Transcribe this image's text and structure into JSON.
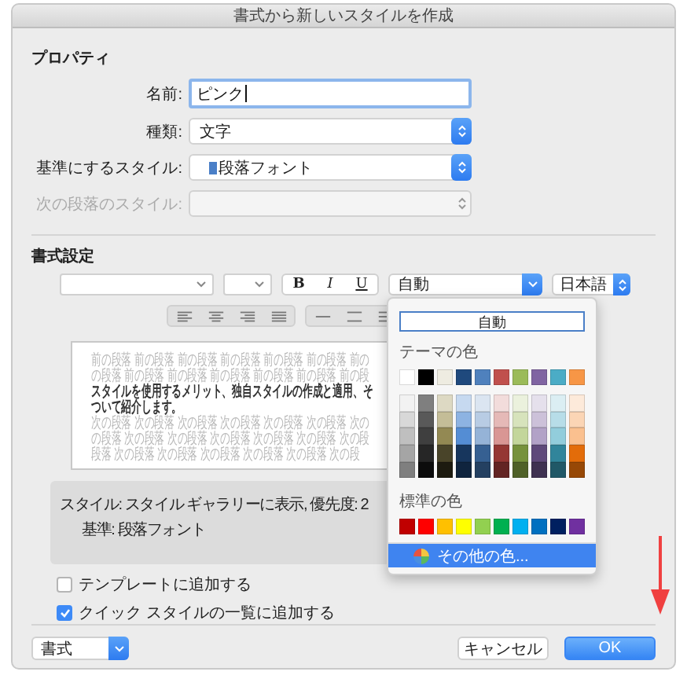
{
  "window": {
    "title": "書式から新しいスタイルを作成"
  },
  "properties": {
    "heading": "プロパティ",
    "fields": [
      {
        "kind": "text",
        "label": "名前:",
        "value": "ピンク",
        "disabled": false
      },
      {
        "kind": "select",
        "label": "種類:",
        "value": "文字",
        "disabled": false
      },
      {
        "kind": "select",
        "label": "基準にするスタイル:",
        "value": "段落フォント",
        "disabled": false
      },
      {
        "kind": "select",
        "label": "次の段落のスタイル:",
        "disabled": true
      }
    ]
  },
  "formatting": {
    "heading": "書式設定",
    "style_buttons": [
      {
        "label": "B",
        "active": false
      },
      {
        "label": "I",
        "active": false
      },
      {
        "label": "U",
        "active": false
      }
    ],
    "color_value": "自動",
    "language": "日本語",
    "preview": [
      {
        "kind": "previous",
        "text": "前の段落 前の段落 前の段落 前の段落 前の段落 前の段落 前の"
      },
      {
        "kind": "previous",
        "text": "の段落 前の段落 前の段落 前の段落 前の段落 前の段落 前の段"
      },
      {
        "kind": "current",
        "text": "スタイルを使用するメリット、独自スタイルの作成と適用、そ"
      },
      {
        "kind": "current",
        "text": "ついて紹介します。"
      },
      {
        "kind": "next",
        "text": "次の段落 次の段落 次の段落 次の段落 次の段落 次の段落 次の"
      },
      {
        "kind": "next",
        "text": "の段落 次の段落 次の段落 次の段落 次の段落 次の段落 次の段"
      },
      {
        "kind": "next",
        "text": "段落 次の段落 次の段落 次の段落 次の段落 次の段落 次の段"
      }
    ],
    "description": [
      "スタイル: スタイル ギャラリーに表示, 優先度: 2",
      "基準: 段落フォント"
    ]
  },
  "checkboxes": [
    {
      "label": "テンプレートに追加する",
      "checked": false
    },
    {
      "label": "クイック スタイルの一覧に追加する",
      "checked": true
    }
  ],
  "color_menu": {
    "auto_button": "自動",
    "theme_heading": "テーマの色",
    "theme_colors": [
      {
        "color": "#ffffff",
        "shades": [
          {
            "color": "#f2f2f2"
          },
          {
            "color": "#d8d8d8"
          },
          {
            "color": "#bfbfbf"
          },
          {
            "color": "#a5a5a5"
          },
          {
            "color": "#7f7f7f"
          }
        ]
      },
      {
        "color": "#000000",
        "shades": [
          {
            "color": "#7f7f7f"
          },
          {
            "color": "#595959"
          },
          {
            "color": "#3f3f3f"
          },
          {
            "color": "#262626"
          },
          {
            "color": "#0c0c0c"
          }
        ]
      },
      {
        "color": "#eeece1",
        "shades": [
          {
            "color": "#ddd9c3"
          },
          {
            "color": "#c4bd97"
          },
          {
            "color": "#938953"
          },
          {
            "color": "#494429"
          },
          {
            "color": "#1d1b10"
          }
        ]
      },
      {
        "color": "#1f497d",
        "shades": [
          {
            "color": "#c6d9f0"
          },
          {
            "color": "#8db3e2"
          },
          {
            "color": "#548dd4"
          },
          {
            "color": "#17365d"
          },
          {
            "color": "#0f243e"
          }
        ]
      },
      {
        "color": "#4f81bd",
        "shades": [
          {
            "color": "#dbe5f1"
          },
          {
            "color": "#b8cce4"
          },
          {
            "color": "#95b3d7"
          },
          {
            "color": "#366092"
          },
          {
            "color": "#244061"
          }
        ]
      },
      {
        "color": "#c0504d",
        "shades": [
          {
            "color": "#f2dcdb"
          },
          {
            "color": "#e5b9b7"
          },
          {
            "color": "#d99694"
          },
          {
            "color": "#953734"
          },
          {
            "color": "#632423"
          }
        ]
      },
      {
        "color": "#9bbb59",
        "shades": [
          {
            "color": "#ebf1dd"
          },
          {
            "color": "#d7e3bc"
          },
          {
            "color": "#c3d69b"
          },
          {
            "color": "#76923c"
          },
          {
            "color": "#4f6128"
          }
        ]
      },
      {
        "color": "#8064a2",
        "shades": [
          {
            "color": "#e5e0ec"
          },
          {
            "color": "#ccc1d9"
          },
          {
            "color": "#b2a2c7"
          },
          {
            "color": "#5f497a"
          },
          {
            "color": "#3f3151"
          }
        ]
      },
      {
        "color": "#4bacc6",
        "shades": [
          {
            "color": "#dbeef3"
          },
          {
            "color": "#b7dde8"
          },
          {
            "color": "#92cddc"
          },
          {
            "color": "#31859b"
          },
          {
            "color": "#205867"
          }
        ]
      },
      {
        "color": "#f79646",
        "shades": [
          {
            "color": "#fdeada"
          },
          {
            "color": "#fbd5b5"
          },
          {
            "color": "#fac08f"
          },
          {
            "color": "#e36c09"
          },
          {
            "color": "#974806"
          }
        ]
      }
    ],
    "standard_heading": "標準の色",
    "standard_colors": [
      {
        "color": "#c00000"
      },
      {
        "color": "#ff0000"
      },
      {
        "color": "#ffc000"
      },
      {
        "color": "#ffff00"
      },
      {
        "color": "#92d050"
      },
      {
        "color": "#00b050"
      },
      {
        "color": "#00b0f0"
      },
      {
        "color": "#0070c0"
      },
      {
        "color": "#002060"
      },
      {
        "color": "#7030a0"
      }
    ],
    "more_item": {
      "label": "その他の色...",
      "selected": true
    }
  },
  "footer": {
    "format_menu": "書式",
    "buttons": [
      {
        "label": "キャンセル",
        "primary": false
      },
      {
        "label": "OK",
        "primary": true
      }
    ]
  }
}
